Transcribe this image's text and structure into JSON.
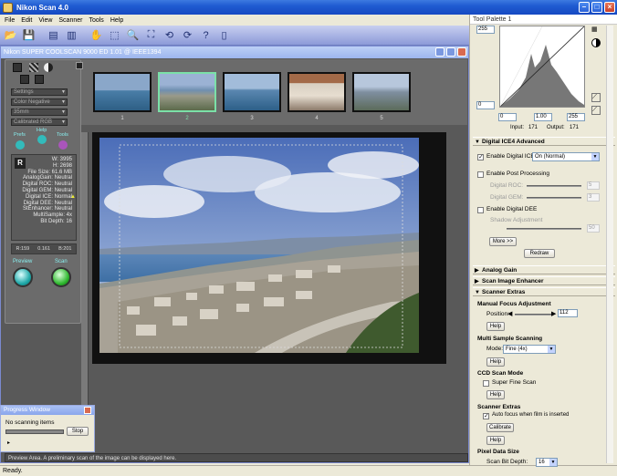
{
  "app": {
    "title": "Nikon Scan 4.0"
  },
  "menu": [
    "File",
    "Edit",
    "View",
    "Scanner",
    "Tools",
    "Help"
  ],
  "child": {
    "title": "Nikon SUPER COOLSCAN 9000 ED 1.01 @ IEEE1394"
  },
  "left": {
    "selects": [
      "Settings",
      "Color Negative",
      "35mm",
      "Calibrated RGB"
    ],
    "prefs": "Prefs",
    "help": "Help",
    "tools": "Tools",
    "info_badge": "R",
    "info": [
      "W: 3995",
      "H: 2698",
      "File Size: 61.6 MB",
      "AnalogGain: Neutral",
      "Digital ROC: Neutral",
      "Digital GEM: Neutral",
      "Digital ICE: Normal",
      "Digital DEE: Neutral",
      "StEnhancer: Neutral",
      "MultiSample: 4x",
      "Bit Depth: 16"
    ],
    "rgb": [
      "R:159",
      "0.161",
      "B:201"
    ],
    "preview": "Preview",
    "scan": "Scan"
  },
  "thumbs": [
    "1",
    "2",
    "3",
    "4",
    "5"
  ],
  "status_msg": "Preview Area. A preliminary scan of the image can be displayed here.",
  "progress": {
    "title": "Progress Window",
    "text": "No scanning items",
    "stop": "Stop"
  },
  "statusbar": "Ready.",
  "palette": {
    "title": "Tool Palette 1",
    "hist": {
      "top": "255",
      "bottom": "0",
      "in_lo": "0",
      "gamma": "1.00",
      "in_hi": "255",
      "input_label": "Input:",
      "input_val": "171",
      "output_label": "Output:",
      "output_val": "171"
    },
    "ice": {
      "header": "Digital ICE4 Advanced",
      "enable_ice": "Enable Digital ICE",
      "ice_mode": "On (Normal)",
      "post": "Enable Post Processing",
      "roc": "Digital ROC:",
      "roc_v": "5",
      "gem": "Digital GEM:",
      "gem_v": "3",
      "dee": "Enable Digital DEE",
      "shadow": "Shadow Adjustment",
      "shadow_v": "50",
      "more": "More >>",
      "redraw": "Redraw"
    },
    "analog": "Analog Gain",
    "enhancer": "Scan Image Enhancer",
    "extras": {
      "header": "Scanner Extras",
      "mf": "Manual Focus Adjustment",
      "pos": "Position:",
      "pos_v": "112",
      "help": "Help",
      "ms": "Multi Sample Scanning",
      "mode": "Mode:",
      "mode_v": "Fine (4x)",
      "ccd": "CCD Scan Mode",
      "superfine": "Super Fine Scan",
      "se": "Scanner Extras",
      "autofocus": "Auto focus when film is inserted",
      "calibrate": "Calibrate",
      "pds": "Pixel Data Size",
      "bitdepth": "Scan Bit Depth:",
      "bitdepth_v": "16"
    }
  }
}
